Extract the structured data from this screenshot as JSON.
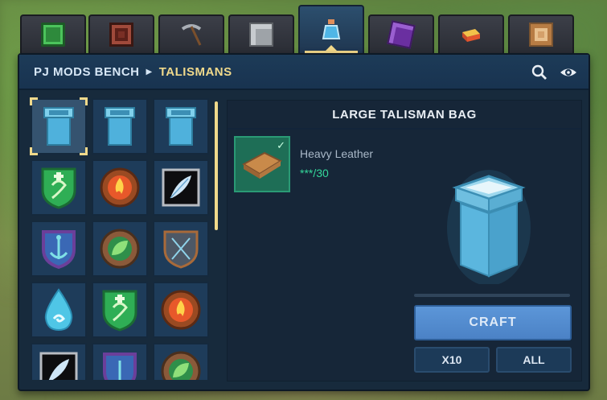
{
  "tabs": [
    {
      "icon": "green-gem-block-icon",
      "active": false,
      "color": "#2f8f3f"
    },
    {
      "icon": "crafting-crate-icon",
      "active": false,
      "color": "#8b3a2f"
    },
    {
      "icon": "pickaxe-icon",
      "active": false,
      "color": "#7a7f86"
    },
    {
      "icon": "gray-block-icon",
      "active": false,
      "color": "#9aa0a6"
    },
    {
      "icon": "blue-potion-icon",
      "active": true,
      "color": "#4fb6e6"
    },
    {
      "icon": "purple-crystal-icon",
      "active": false,
      "color": "#7b3fb0"
    },
    {
      "icon": "gold-bar-icon",
      "active": false,
      "color": "#e3a12b"
    },
    {
      "icon": "target-block-icon",
      "active": false,
      "color": "#c48a4a"
    }
  ],
  "header": {
    "breadcrumb_root": "PJ MODS BENCH",
    "breadcrumb_current": "TALISMANS",
    "search_icon": "search-icon",
    "view_icon": "eye-icon"
  },
  "grid": [
    {
      "icon": "talisman-bag-icon",
      "selected": true
    },
    {
      "icon": "talisman-bag-icon",
      "selected": false
    },
    {
      "icon": "talisman-bag-icon",
      "selected": false
    },
    {
      "icon": "green-serpent-shield-icon",
      "selected": false
    },
    {
      "icon": "fire-medallion-icon",
      "selected": false
    },
    {
      "icon": "feather-tablet-icon",
      "selected": false
    },
    {
      "icon": "anchor-crest-icon",
      "selected": false
    },
    {
      "icon": "leaf-medallion-icon",
      "selected": false
    },
    {
      "icon": "stone-shield-icon",
      "selected": false
    },
    {
      "icon": "water-drop-icon",
      "selected": false
    },
    {
      "icon": "green-serpent-shield-icon",
      "selected": false
    },
    {
      "icon": "fire-medallion-icon",
      "selected": false
    },
    {
      "icon": "feather-tablet-icon",
      "selected": false
    },
    {
      "icon": "anchor-crest-icon",
      "selected": false
    },
    {
      "icon": "leaf-medallion-icon",
      "selected": false
    }
  ],
  "detail": {
    "title": "LARGE TALISMAN BAG",
    "ingredient_name": "Heavy Leather",
    "ingredient_count": "***/30",
    "ingredient_icon": "leather-icon",
    "craft_label": "CRAFT",
    "x10_label": "X10",
    "all_label": "ALL"
  },
  "colors": {
    "accent": "#f0d98b",
    "craft": "#5c96d8",
    "ingredient_ok": "#34d89b"
  }
}
